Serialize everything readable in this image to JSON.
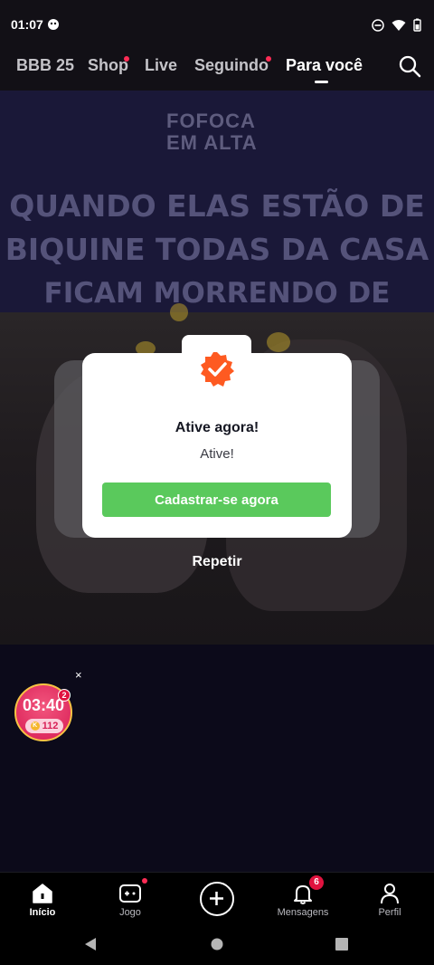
{
  "status_bar": {
    "time": "01:07"
  },
  "top_tabs": {
    "items": [
      {
        "label": "BBB 25",
        "dot": false
      },
      {
        "label": "Shop",
        "dot": true
      },
      {
        "label": "Live",
        "dot": false
      },
      {
        "label": "Seguindo",
        "dot": true
      },
      {
        "label": "Para você",
        "dot": false
      }
    ],
    "active": "Para você"
  },
  "video": {
    "logo_text": [
      "FOFOCA",
      "EM ALTA"
    ],
    "caption_lines": [
      "QUANDO ELAS ESTÃO DE",
      "BIQUINE TODAS DA CASA",
      "FICAM MORRENDO DE INVEJA"
    ],
    "replay_label": "Repetir"
  },
  "modal": {
    "title": "Ative agora!",
    "subtitle": "Ative!",
    "button_label": "Cadastrar-se agora",
    "icon": "verified-badge-icon",
    "badge_color": "#fe5a21",
    "button_color": "#5ac95c"
  },
  "timer_widget": {
    "time": "03:40",
    "coins": "112",
    "coin_symbol": "K",
    "badge": "2",
    "close": "×"
  },
  "bottom_nav": {
    "items": [
      {
        "label": "Início",
        "icon": "home-icon",
        "active": true
      },
      {
        "label": "Jogo",
        "icon": "game-icon",
        "dot": true
      },
      {
        "label": "",
        "icon": "plus-icon"
      },
      {
        "label": "Mensagens",
        "icon": "bell-icon",
        "count": "6"
      },
      {
        "label": "Perfil",
        "icon": "profile-icon"
      }
    ]
  },
  "accent_color": "#fe2c55"
}
